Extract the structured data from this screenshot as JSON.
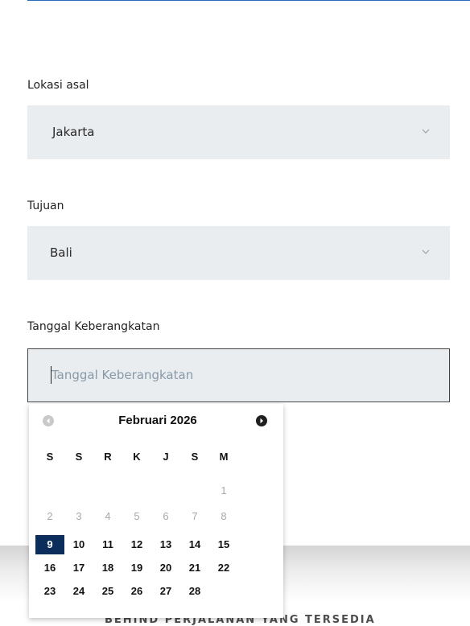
{
  "form": {
    "origin": {
      "label": "Lokasi asal",
      "value": "Jakarta"
    },
    "destination": {
      "label": "Tujuan",
      "value": "Bali"
    },
    "departure_date": {
      "label": "Tanggal Keberangkatan",
      "placeholder": "Tanggal Keberangkatan"
    }
  },
  "calendar": {
    "title": "Februari 2026",
    "weekdays": [
      "S",
      "S",
      "R",
      "K",
      "J",
      "S",
      "M"
    ],
    "selected_day": "9",
    "weeks": [
      [
        {
          "d": ""
        },
        {
          "d": ""
        },
        {
          "d": ""
        },
        {
          "d": ""
        },
        {
          "d": ""
        },
        {
          "d": ""
        },
        {
          "d": "1",
          "muted": true
        }
      ],
      [
        {
          "d": "2",
          "muted": true
        },
        {
          "d": "3",
          "muted": true
        },
        {
          "d": "4",
          "muted": true
        },
        {
          "d": "5",
          "muted": true
        },
        {
          "d": "6",
          "muted": true
        },
        {
          "d": "7",
          "muted": true
        },
        {
          "d": "8",
          "muted": true
        }
      ],
      [
        {
          "d": "9",
          "selected": true
        },
        {
          "d": "10"
        },
        {
          "d": "11"
        },
        {
          "d": "12"
        },
        {
          "d": "13"
        },
        {
          "d": "14"
        },
        {
          "d": "15"
        }
      ],
      [
        {
          "d": "16"
        },
        {
          "d": "17"
        },
        {
          "d": "18"
        },
        {
          "d": "19"
        },
        {
          "d": "20"
        },
        {
          "d": "21"
        },
        {
          "d": "22"
        }
      ],
      [
        {
          "d": "23"
        },
        {
          "d": "24"
        },
        {
          "d": "25"
        },
        {
          "d": "26"
        },
        {
          "d": "27"
        },
        {
          "d": "28"
        },
        {
          "d": ""
        }
      ]
    ]
  },
  "colors": {
    "accent_line": "#2f67b9",
    "field_bg": "#e9edf0",
    "selected_day_bg": "#0b2d5c",
    "placeholder": "#8899a8"
  },
  "icons": {
    "select_chevron": "chevron-down-icon",
    "prev_month": "chevron-left-circle-icon",
    "next_month": "chevron-right-circle-icon"
  },
  "footer": {
    "partial_text": "BEHIND PERJALANAN YANG TERSEDIA"
  }
}
